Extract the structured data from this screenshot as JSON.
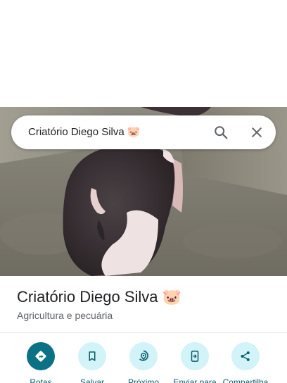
{
  "search": {
    "query": "Criatório Diego Silva 🐷",
    "search_icon": "search-icon",
    "close_icon": "close-icon"
  },
  "place": {
    "name": "Criatório Diego Silva 🐷",
    "category": "Agricultura e pecuária"
  },
  "actions": [
    {
      "label": "Rotas",
      "icon": "directions-icon",
      "primary": true
    },
    {
      "label": "Salvar",
      "icon": "bookmark-icon",
      "primary": false
    },
    {
      "label": "Próximo",
      "icon": "nearby-icon",
      "primary": false
    },
    {
      "label": "Enviar para",
      "icon": "send-to-phone-icon",
      "primary": false
    },
    {
      "label": "Compartilha",
      "icon": "share-icon",
      "primary": false
    }
  ],
  "colors": {
    "accent": "#0b7285",
    "action_bg": "#d2f3f7",
    "label": "#0b5e6b"
  }
}
